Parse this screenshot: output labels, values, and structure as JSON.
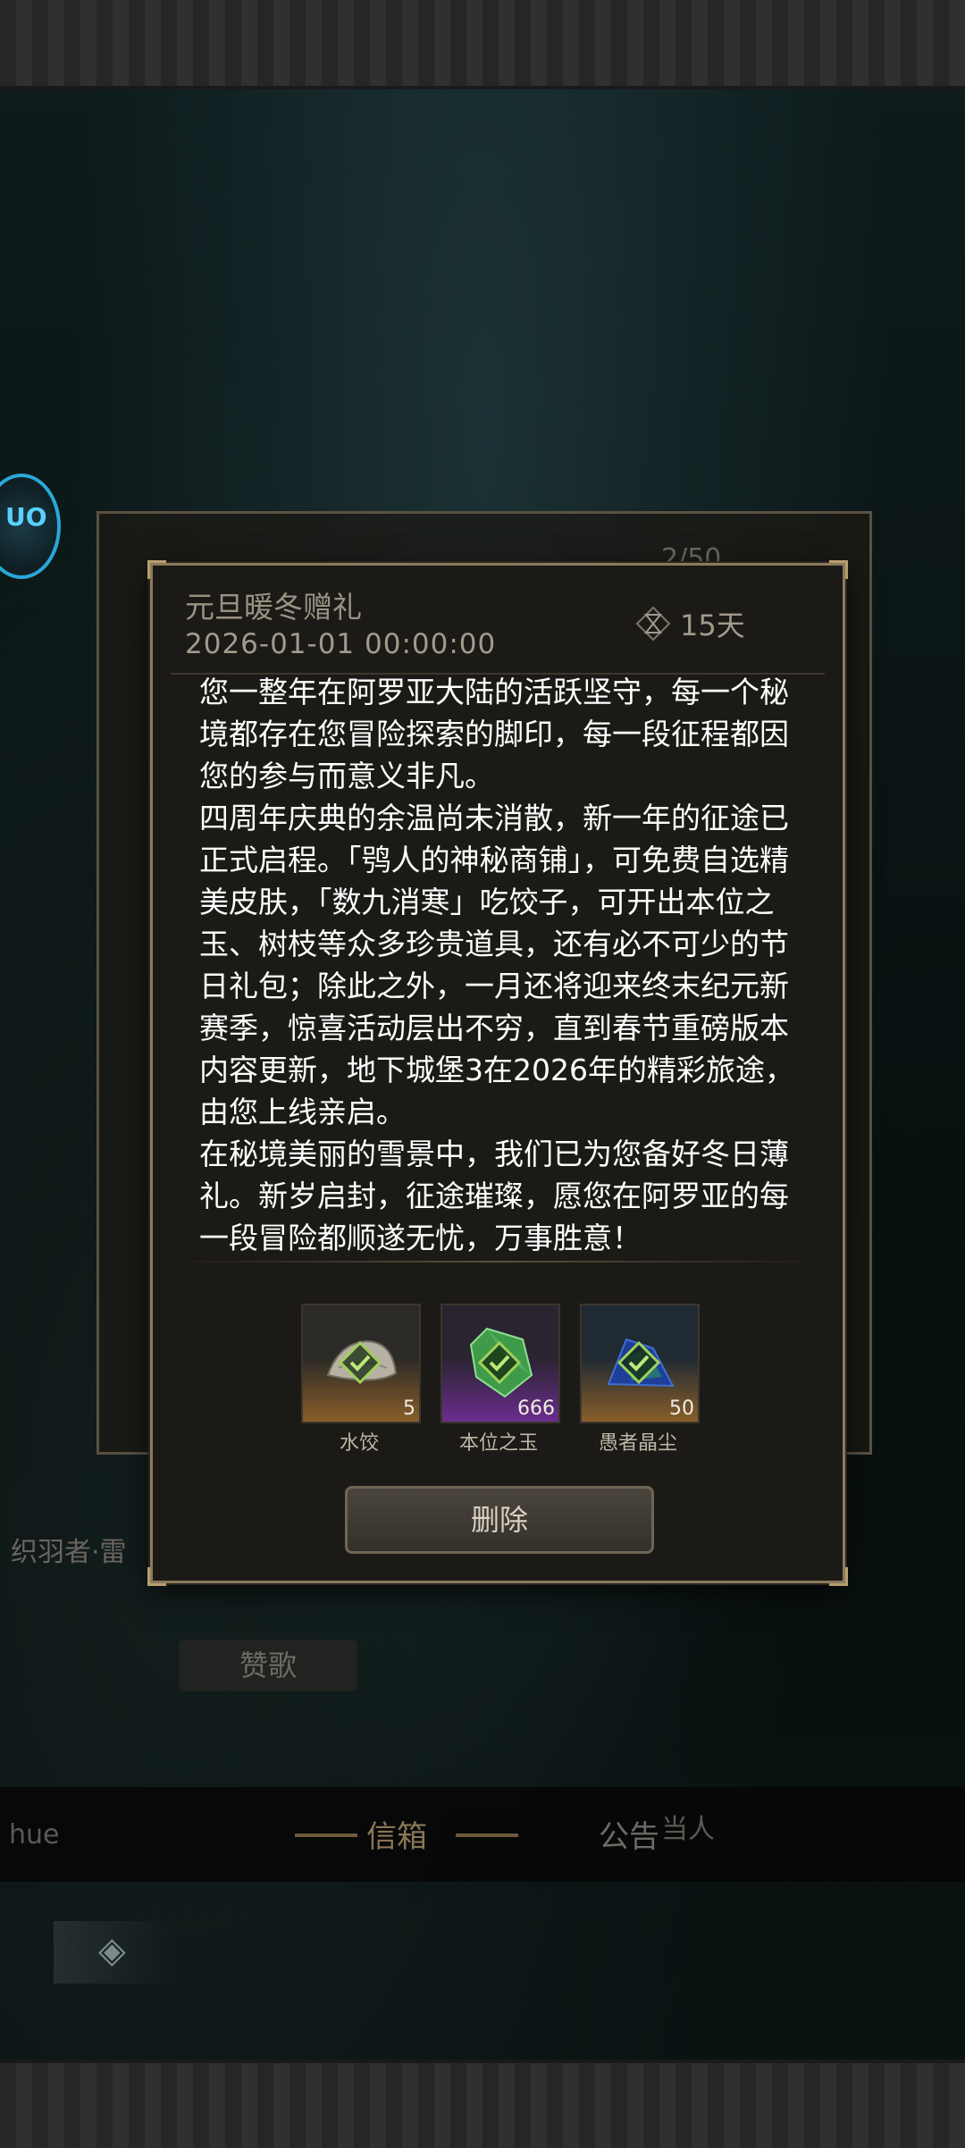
{
  "background": {
    "under_panel_counter": "2/50",
    "left_text": "织羽者·雷",
    "under_button": "赞歌",
    "side_badge_text": "UO"
  },
  "tabs": {
    "left_partial": "hue",
    "mail": "信箱",
    "notice": "公告",
    "right_partial": "当人"
  },
  "mail": {
    "title": "元旦暖冬赠礼",
    "date": "2026-01-01  00:00:00",
    "expire": "15天",
    "paragraphs": [
      "您一整年在阿罗亚大陆的活跃坚守，每一个秘境都存在您冒险探索的脚印，每一段征程都因您的参与而意义非凡。",
      "四周年庆典的余温尚未消散，新一年的征途已正式启程。「鸮人的神秘商铺」，可免费自选精美皮肤，「数九消寒」吃饺子，可开出本位之玉、树枝等众多珍贵道具，还有必不可少的节日礼包；除此之外，一月还将迎来终末纪元新赛季，惊喜活动层出不穷，直到春节重磅版本内容更新，地下城堡3在2026年的精彩旅途，由您上线亲启。",
      "在秘境美丽的雪景中，我们已为您备好冬日薄礼。新岁启封，征途璀璨，愿您在阿罗亚的每一段冒险都顺遂无忧，万事胜意！"
    ],
    "rewards": [
      {
        "name": "水饺",
        "qty": "5",
        "icon": "dumpling-icon"
      },
      {
        "name": "本位之玉",
        "qty": "666",
        "icon": "green-gem-icon"
      },
      {
        "name": "愚者晶尘",
        "qty": "50",
        "icon": "crystal-dust-icon"
      }
    ],
    "delete_label": "删除"
  },
  "colors": {
    "accent": "#8c7a5c",
    "check_green": "#9fd15a",
    "tab_active": "#8a7656"
  }
}
